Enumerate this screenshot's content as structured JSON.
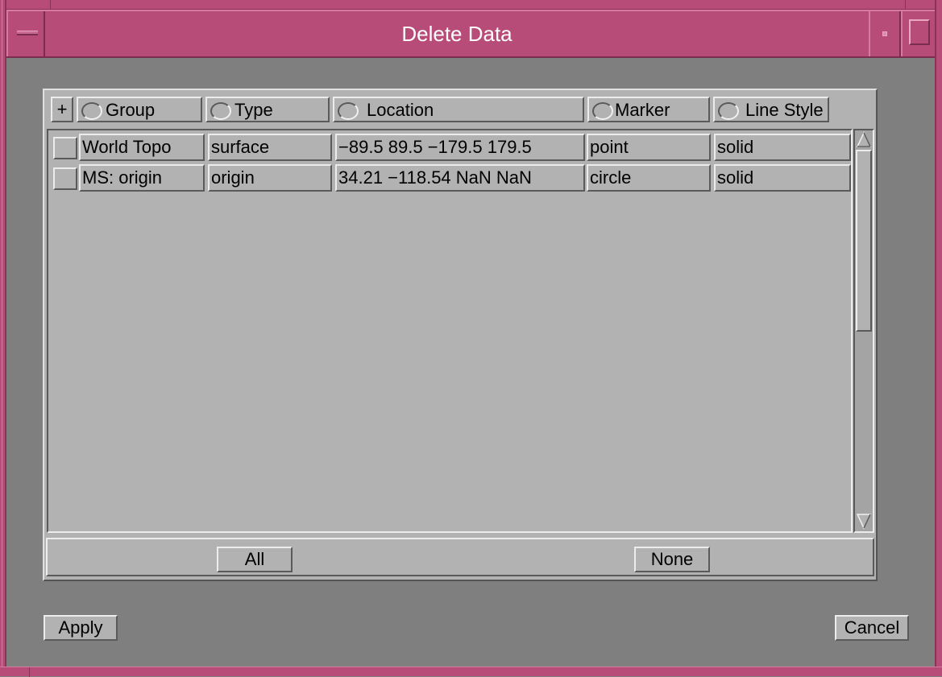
{
  "window": {
    "title": "Delete Data"
  },
  "header": {
    "expand_label": "+",
    "columns": [
      "Group",
      "Type",
      "Location",
      "Marker",
      "Line Style"
    ]
  },
  "rows": [
    {
      "group": "World Topo",
      "type": "surface",
      "location": "−89.5 89.5 −179.5 179.5",
      "marker": "point",
      "line_style": "solid"
    },
    {
      "group": "MS: origin",
      "type": "origin",
      "location": "34.21 −118.54 NaN NaN",
      "marker": "circle",
      "line_style": "solid"
    }
  ],
  "selection": {
    "all_label": "All",
    "none_label": "None"
  },
  "actions": {
    "apply_label": "Apply",
    "cancel_label": "Cancel"
  },
  "colors": {
    "title_bar": "#b84c78",
    "title_text": "#ffffff",
    "panel": "#b2b2b2",
    "background": "#7f7f7f"
  },
  "icons": {
    "window_menu": "window-menu-icon",
    "minimize": "minimize-icon",
    "maximize": "maximize-icon",
    "scroll_up": "arrow-up-icon",
    "scroll_down": "arrow-down-icon"
  }
}
